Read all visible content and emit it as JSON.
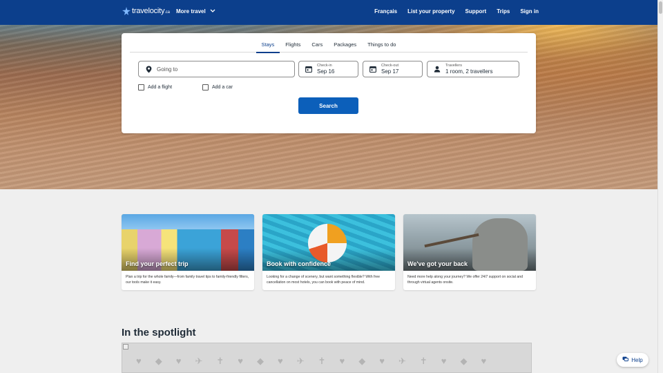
{
  "header": {
    "logo_text": "travelocity",
    "logo_suffix": ".ca",
    "more_travel": "More travel",
    "nav": [
      "Français",
      "List your property",
      "Support",
      "Trips",
      "Sign in"
    ]
  },
  "search": {
    "tabs": [
      "Stays",
      "Flights",
      "Cars",
      "Packages",
      "Things to do"
    ],
    "active_tab": "Stays",
    "going_to_placeholder": "Going to",
    "checkin_label": "Check-in",
    "checkin_value": "Sep 16",
    "checkout_label": "Check-out",
    "checkout_value": "Sep 17",
    "travellers_label": "Travellers",
    "travellers_value": "1 room, 2 travellers",
    "add_flight": "Add a flight",
    "add_car": "Add a car",
    "search_button": "Search"
  },
  "features": [
    {
      "title": "Find your perfect trip",
      "desc": "Plan a trip for the whole family—from family travel tips to family-friendly filters, our tools make it easy."
    },
    {
      "title": "Book with confidence",
      "desc": "Looking for a change of scenery, but want something flexible? With free cancellation on most hotels, you can book with peace of mind."
    },
    {
      "title": "We've got your back",
      "desc": "Need more help along your journey? We offer 24/7 support on social and through virtual agents onsite."
    }
  ],
  "spotlight": {
    "title": "In the spotlight"
  },
  "help": {
    "label": "Help"
  },
  "colors": {
    "brand": "#0c3f8c",
    "button": "#0c5fba"
  }
}
